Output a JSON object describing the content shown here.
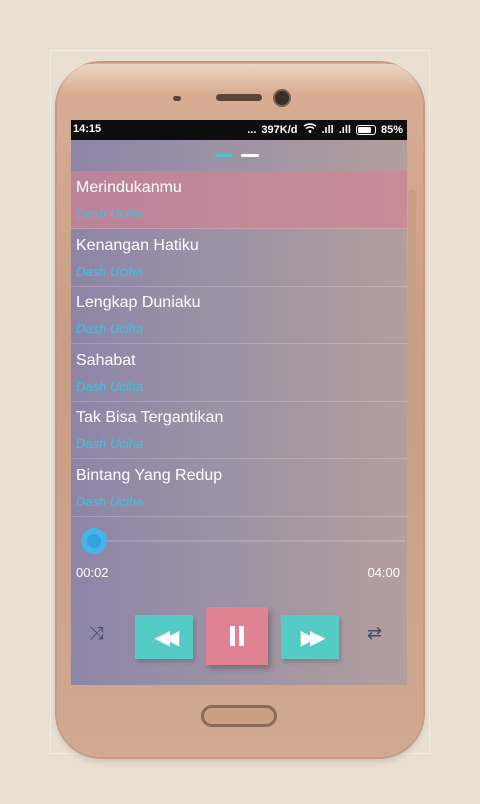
{
  "status_bar": {
    "time": "14:15",
    "dots": "...",
    "speed": "397K/d",
    "wifi_icon": "wifi-icon",
    "signal1": ".ıll",
    "signal2": ".ıll",
    "battery_icon": "battery-icon",
    "battery": "85%"
  },
  "pager": {
    "count": 2,
    "active_index": 1
  },
  "playlist": [
    {
      "title": "Merindukanmu",
      "artist": "Dash Uciha",
      "current": true
    },
    {
      "title": "Kenangan Hatiku",
      "artist": "Dash Uciha"
    },
    {
      "title": "Lengkap Duniaku",
      "artist": "Dash Uciha"
    },
    {
      "title": "Sahabat",
      "artist": "Dash Uciha"
    },
    {
      "title": "Tak Bisa Tergantikan",
      "artist": "Dash Uciha"
    },
    {
      "title": "Bintang Yang Redup",
      "artist": "Dash Uciha"
    }
  ],
  "player": {
    "elapsed": "00:02",
    "duration": "04:00",
    "progress": 0.0083,
    "shuffle_icon": "⤨",
    "prev_icon": "◀◀",
    "next_icon": "▶▶",
    "repeat_icon": "⇄"
  },
  "colors": {
    "accent_teal": "#55cbc6",
    "accent_pink": "#df8393",
    "artist_blue": "#42bfe0",
    "seek_blue": "#2fa3df"
  }
}
